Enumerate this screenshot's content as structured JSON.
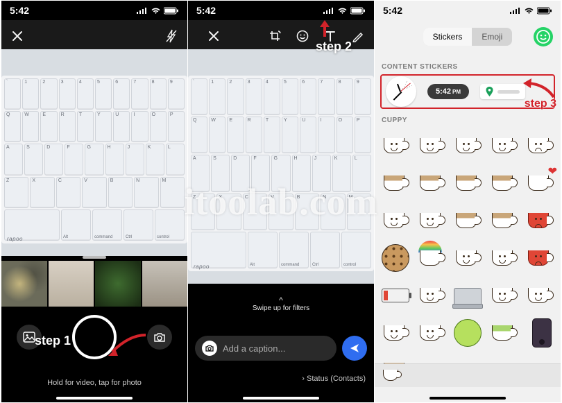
{
  "statusbar": {
    "time": "5:42"
  },
  "panel1": {
    "step_label": "step 1",
    "hint": "Hold for video, tap for photo",
    "brand": "rapoo",
    "bottom_keys": [
      "Alt",
      "Ctrl"
    ],
    "small_keys": [
      "command",
      "control"
    ]
  },
  "panel2": {
    "step_label": "step 2",
    "swipe_hint": "Swipe up for filters",
    "caption_placeholder": "Add a caption...",
    "status_text": "Status (Contacts)",
    "brand": "rapoo",
    "bottom_keys": [
      "Alt",
      "Ctrl"
    ],
    "small_keys": [
      "command",
      "control"
    ]
  },
  "panel3": {
    "tabs": {
      "stickers": "Stickers",
      "emoji": "Emoji"
    },
    "section_content": "CONTENT STICKERS",
    "section_cuppy": "CUPPY",
    "time_sticker": {
      "hhmm": "5:42",
      "ampm": "PM"
    },
    "step_label": "step 3"
  },
  "keyboard_rows": {
    "num": [
      "`",
      "1",
      "2",
      "3",
      "4",
      "5",
      "6",
      "7",
      "8",
      "9"
    ],
    "top": [
      "Q",
      "W",
      "E",
      "R",
      "T",
      "Y",
      "U",
      "I",
      "O",
      "P"
    ],
    "mid": [
      "A",
      "S",
      "D",
      "F",
      "G",
      "H",
      "J",
      "K",
      "L"
    ],
    "low": [
      "Z",
      "X",
      "C",
      "V",
      "B",
      "N",
      "M"
    ]
  },
  "watermark": "itoolab.com"
}
